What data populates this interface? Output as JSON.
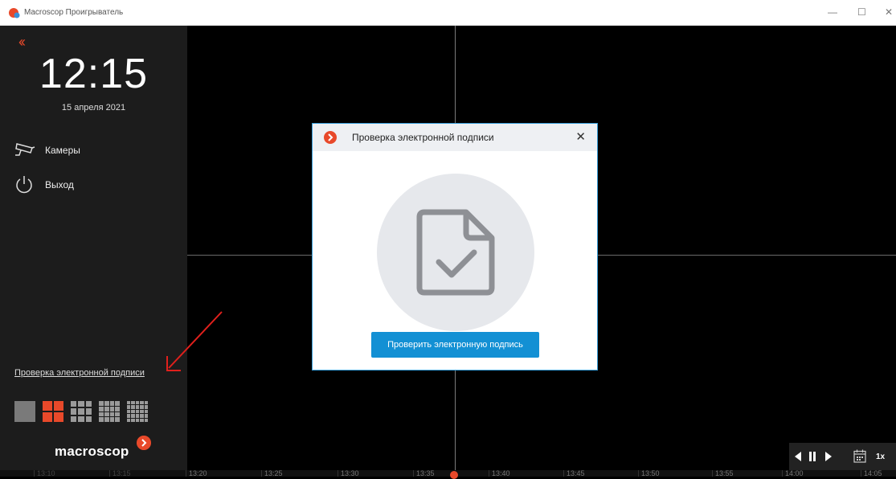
{
  "window": {
    "title": "Macroscop Проигрыватель",
    "minimize": "—",
    "maximize": "☐",
    "close": "✕"
  },
  "sidebar": {
    "back_icon": "double-chevron-left",
    "back_label": "‹‹",
    "time": "12:15",
    "date": "15 апреля 2021",
    "menu": [
      {
        "label": "Камеры",
        "icon": "camera-icon"
      },
      {
        "label": "Выход",
        "icon": "power-icon"
      }
    ],
    "signature_link": "Проверка электронной подписи",
    "layouts": [
      {
        "grid": 1,
        "active": false
      },
      {
        "grid": 2,
        "active": true
      },
      {
        "grid": 3,
        "active": false
      },
      {
        "grid": 4,
        "active": false
      },
      {
        "grid": 5,
        "active": false
      }
    ],
    "logo_text": "macroscop"
  },
  "dialog": {
    "title": "Проверка электронной подписи",
    "close_label": "✕",
    "verify_button": "Проверить электронную подпись"
  },
  "timeline": {
    "ticks": [
      "13:10",
      "13:15",
      "13:20",
      "13:25",
      "13:30",
      "13:35",
      "13:40",
      "13:45",
      "13:50",
      "13:55",
      "14:00",
      "14:05"
    ]
  },
  "playback": {
    "speed": "1x"
  },
  "colors": {
    "accent": "#e8492a",
    "primary_button": "#1390d4",
    "dialog_border": "#3aa0db",
    "sidebar_bg": "#1c1c1c"
  }
}
